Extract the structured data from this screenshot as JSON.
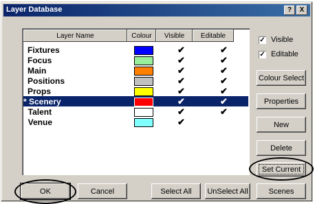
{
  "window": {
    "title": "Layer Database",
    "help_btn": "?",
    "close_btn": "X"
  },
  "columns": {
    "name": "Layer Name",
    "colour": "Colour",
    "visible": "Visible",
    "editable": "Editable"
  },
  "layers": [
    {
      "name": "Fixtures",
      "colour": "#0000ff",
      "visible": "✔",
      "editable": "✔"
    },
    {
      "name": "Focus",
      "colour": "#99ee99",
      "visible": "✔",
      "editable": "✔"
    },
    {
      "name": "Main",
      "colour": "#ff8000",
      "visible": "✔",
      "editable": "✔"
    },
    {
      "name": "Positions",
      "colour": "#c0c0c0",
      "visible": "✔",
      "editable": "✔"
    },
    {
      "name": "Props",
      "colour": "#ffff00",
      "visible": "✔",
      "editable": "✔"
    },
    {
      "name": "* Scenery",
      "colour": "#ff0000",
      "visible": "✔",
      "editable": "✔"
    },
    {
      "name": "  Talent",
      "colour": "#ffffff",
      "visible": "✔",
      "editable": "✔"
    },
    {
      "name": "  Venue",
      "colour": "#80ffff",
      "visible": "✔",
      "editable": ""
    }
  ],
  "checkboxes": {
    "visible_label": "Visible",
    "visible_checked": "✓",
    "editable_label": "Editable",
    "editable_checked": "✓"
  },
  "side_buttons": {
    "colour_select": "Colour Select",
    "properties": "Properties",
    "new": "New",
    "delete": "Delete",
    "set_current": "Set Current"
  },
  "bottom_buttons": {
    "ok": "OK",
    "cancel": "Cancel",
    "select_all": "Select All",
    "unselect_all": "UnSelect All",
    "scenes": "Scenes"
  }
}
